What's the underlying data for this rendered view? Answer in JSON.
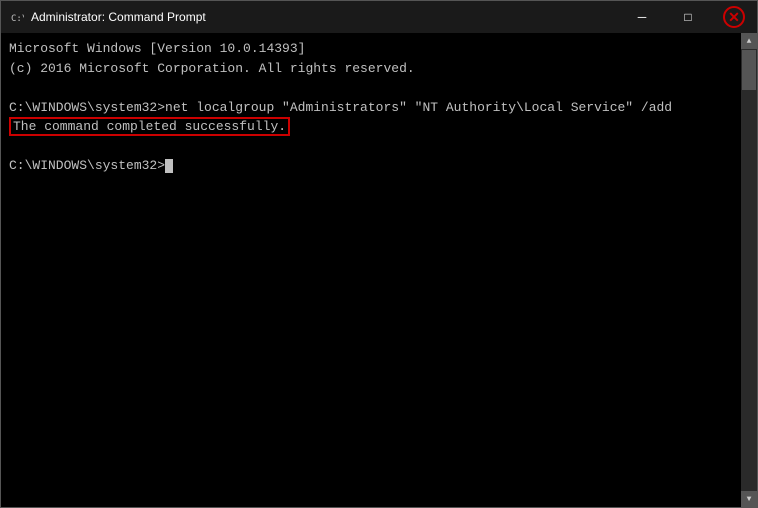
{
  "titleBar": {
    "icon": "cmd-icon",
    "title": "Administrator: Command Prompt",
    "minimizeLabel": "─",
    "maximizeLabel": "□",
    "closeLabel": "✕"
  },
  "terminal": {
    "line1": "Microsoft Windows [Version 10.0.14393]",
    "line2": "(c) 2016 Microsoft Corporation. All rights reserved.",
    "line3": "",
    "line4": "C:\\WINDOWS\\system32>net localgroup \"Administrators\" \"NT Authority\\Local Service\" /add",
    "line5_highlighted": "The command completed successfully.",
    "line6": "",
    "line7": "C:\\WINDOWS\\system32>"
  }
}
